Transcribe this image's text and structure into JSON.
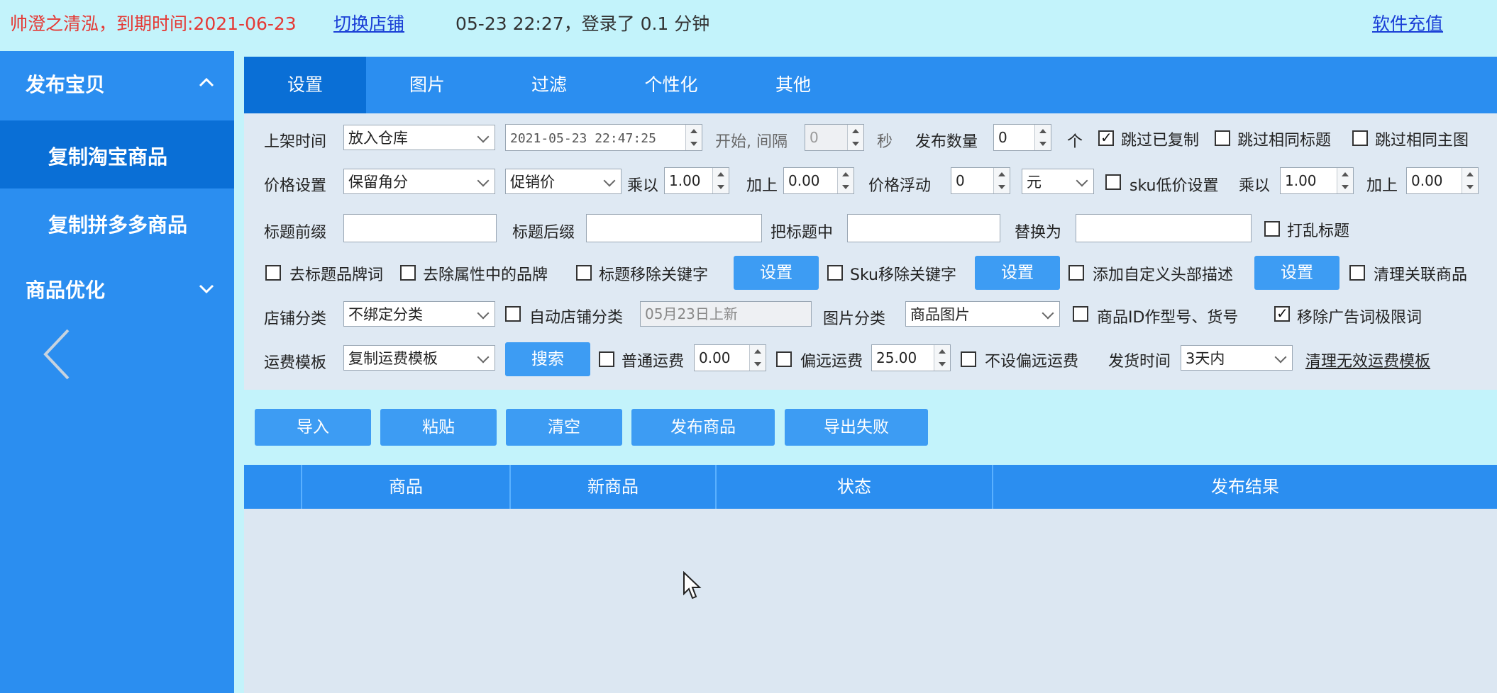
{
  "topbar": {
    "account_expiry": "帅澄之清泓，到期时间:2021-06-23",
    "switch_shop": "切换店铺",
    "session": "05-23 22:27，登录了 0.1 分钟",
    "recharge": "软件充值"
  },
  "sidebar": {
    "groups": [
      {
        "label": "发布宝贝",
        "expanded": true
      },
      {
        "label": "商品优化",
        "expanded": false
      }
    ],
    "items": [
      {
        "label": "复制淘宝商品",
        "active": true
      },
      {
        "label": "复制拼多多商品",
        "active": false
      }
    ]
  },
  "tabs": [
    {
      "label": "设置",
      "active": true
    },
    {
      "label": "图片"
    },
    {
      "label": "过滤"
    },
    {
      "label": "个性化"
    },
    {
      "label": "其他"
    }
  ],
  "form": {
    "row1": {
      "listing_time_label": "上架时间",
      "listing_time_value": "放入仓库",
      "datetime_value": "2021-05-23 22:47:25",
      "start_interval_label": "开始, 间隔",
      "interval_value": "0",
      "seconds_label": "秒",
      "publish_count_label": "发布数量",
      "publish_count_value": "0",
      "unit_label": "个",
      "skip_copied_label": "跳过已复制",
      "skip_same_title_label": "跳过相同标题",
      "skip_same_main_image_label": "跳过相同主图"
    },
    "row2": {
      "price_setting_label": "价格设置",
      "price_setting_value": "保留角分",
      "price_type_value": "促销价",
      "multiply_label": "乘以",
      "multiply_value": "1.00",
      "add_label": "加上",
      "add_value": "0.00",
      "float_label": "价格浮动",
      "float_value": "0",
      "float_unit_value": "元",
      "sku_low_price_label": "sku低价设置",
      "multiply2_label": "乘以",
      "multiply2_value": "1.00",
      "add2_label": "加上",
      "add2_value": "0.00"
    },
    "row3": {
      "title_prefix_label": "标题前缀",
      "title_prefix_value": "",
      "title_suffix_label": "标题后缀",
      "title_suffix_value": "",
      "replace_in_title_label": "把标题中",
      "replace_in_title_value": "",
      "replace_with_label": "替换为",
      "replace_with_value": "",
      "shuffle_title_label": "打乱标题"
    },
    "row4": {
      "remove_title_brand_label": "去标题品牌词",
      "remove_attr_brand_label": "去除属性中的品牌",
      "title_remove_keywords_label": "标题移除关键字",
      "settings_btn_1": "设置",
      "sku_remove_keywords_label": "Sku移除关键字",
      "settings_btn_2": "设置",
      "add_header_desc_label": "添加自定义头部描述",
      "settings_btn_3": "设置",
      "clear_related_label": "清理关联商品"
    },
    "row5": {
      "shop_category_label": "店铺分类",
      "shop_category_value": "不绑定分类",
      "auto_shop_category_label": "自动店铺分类",
      "auto_category_placeholder": "05月23日上新",
      "image_category_label": "图片分类",
      "image_category_value": "商品图片",
      "product_id_label": "商品ID作型号、货号",
      "remove_ad_words_label": "移除广告词极限词"
    },
    "row6": {
      "shipping_template_label": "运费模板",
      "shipping_template_value": "复制运费模板",
      "search_btn": "搜索",
      "normal_shipping_label": "普通运费",
      "normal_shipping_value": "0.00",
      "remote_shipping_label": "偏远运费",
      "remote_shipping_value": "25.00",
      "no_remote_label": "不设偏远运费",
      "ship_time_label": "发货时间",
      "ship_time_value": "3天内",
      "clean_invalid_templates": "清理无效运费模板"
    }
  },
  "actions": {
    "import": "导入",
    "paste": "粘贴",
    "clear": "清空",
    "publish": "发布商品",
    "export_failed": "导出失败"
  },
  "table": {
    "columns": [
      "",
      "商品",
      "新商品",
      "状态",
      "发布结果"
    ]
  }
}
